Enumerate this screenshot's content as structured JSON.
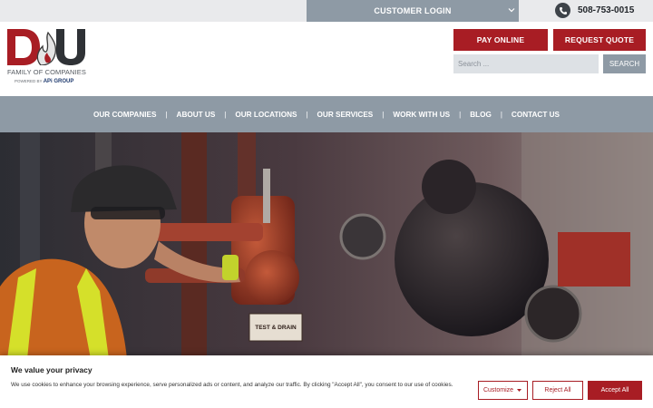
{
  "topbar": {
    "customer_login_label": "CUSTOMER LOGIN",
    "phone": "508-753-0015"
  },
  "logo": {
    "tagline": "FAMILY OF COMPANIES",
    "powered_by_prefix": "POWERED BY",
    "powered_by_brand": "APi GROUP"
  },
  "header": {
    "pay_online_label": "PAY ONLINE",
    "request_quote_label": "REQUEST QUOTE",
    "search_placeholder": "Search ...",
    "search_button_label": "SEARCH"
  },
  "nav": {
    "items": [
      {
        "label": "OUR COMPANIES"
      },
      {
        "label": "ABOUT US"
      },
      {
        "label": "OUR LOCATIONS"
      },
      {
        "label": "OUR SERVICES"
      },
      {
        "label": "WORK WITH US"
      },
      {
        "label": "BLOG"
      },
      {
        "label": "CONTACT US"
      }
    ],
    "separator": "|"
  },
  "hero": {
    "sign_text": "TEST & DRAIN"
  },
  "cookie_banner": {
    "title": "We value your privacy",
    "text": "We use cookies to enhance your browsing experience, serve personalized ads or content, and analyze our traffic. By clicking \"Accept All\", you consent to our use of cookies.",
    "customize_label": "Customize",
    "reject_label": "Reject All",
    "accept_label": "Accept All"
  },
  "colors": {
    "brand_red": "#a81d24",
    "nav_gray": "#8e9aa5",
    "topbar_bg": "#e9eaec"
  },
  "icons": [
    "phone-icon",
    "chevron-down-icon",
    "caret-down-icon"
  ]
}
